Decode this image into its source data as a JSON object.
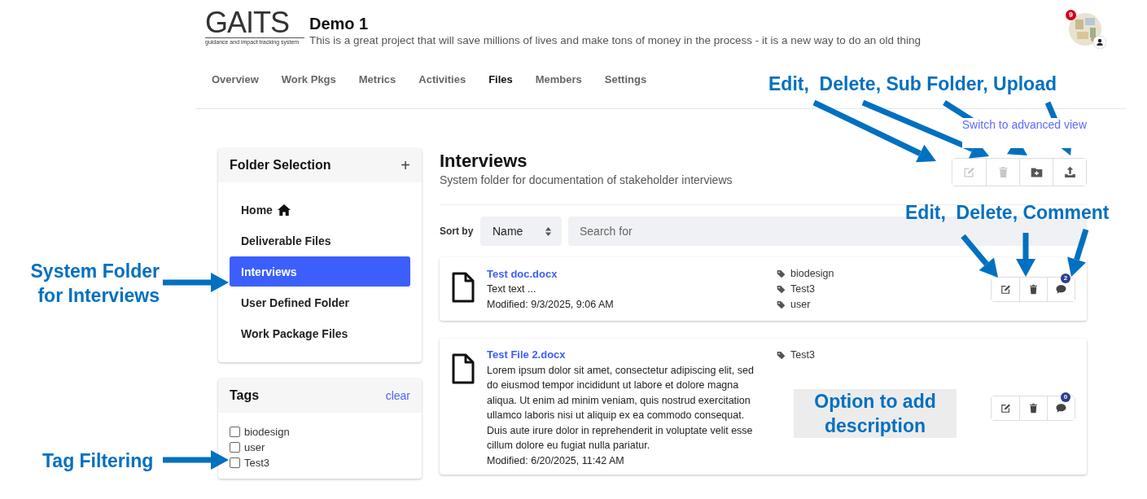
{
  "project": {
    "logo": "GAITS",
    "tagline": "guidance and impact tracking system",
    "title": "Demo 1",
    "description": "This is a great project that will save millions of lives and make tons of money in the process - it is a new way to do an old thing",
    "notifications": "9"
  },
  "tabs": [
    {
      "label": "Overview",
      "selected": false
    },
    {
      "label": "Work Pkgs",
      "selected": false
    },
    {
      "label": "Metrics",
      "selected": false
    },
    {
      "label": "Activities",
      "selected": false
    },
    {
      "label": "Files",
      "selected": true
    },
    {
      "label": "Members",
      "selected": false
    },
    {
      "label": "Settings",
      "selected": false
    }
  ],
  "view_link": "Switch to advanced view",
  "folder_panel": {
    "title": "Folder Selection",
    "add": "+",
    "folders": [
      {
        "label": "Home",
        "kind": "home",
        "selected": false
      },
      {
        "label": "Deliverable Files",
        "kind": "folder",
        "selected": false
      },
      {
        "label": "Interviews",
        "kind": "folder",
        "selected": true
      },
      {
        "label": "User Defined Folder",
        "kind": "folder",
        "selected": false
      },
      {
        "label": "Work Package Files",
        "kind": "folder",
        "selected": false
      }
    ]
  },
  "tags_panel": {
    "title": "Tags",
    "clear": "clear",
    "tags": [
      {
        "label": "biodesign",
        "checked": false
      },
      {
        "label": "user",
        "checked": false
      },
      {
        "label": "Test3",
        "checked": false
      }
    ]
  },
  "folder": {
    "title": "Interviews",
    "description": "System folder for documentation of stakeholder interviews",
    "actions": [
      {
        "kind": "edit",
        "disabled": true
      },
      {
        "kind": "delete",
        "disabled": true
      },
      {
        "kind": "subfolder",
        "disabled": false
      },
      {
        "kind": "upload",
        "disabled": false
      }
    ]
  },
  "sort": {
    "label": "Sort by",
    "value": "Name"
  },
  "search": {
    "placeholder": "Search for"
  },
  "files": [
    {
      "name": "Test doc.docx",
      "description": "Text text ...",
      "modified": "Modified: 9/3/2025, 9:06 AM",
      "tags": [
        "biodesign",
        "Test3",
        "user"
      ],
      "comments": "2"
    },
    {
      "name": "Test File 2.docx",
      "description": "Lorem ipsum dolor sit amet, consectetur adipiscing elit, sed do eiusmod tempor incididunt ut labore et dolore magna aliqua. Ut enim ad minim veniam, quis nostrud exercitation ullamco laboris nisi ut aliquip ex ea commodo consequat. Duis aute irure dolor in reprehenderit in voluptate velit esse cillum dolore eu fugiat nulla pariatur.",
      "modified": "Modified: 6/20/2025, 11:42 AM",
      "tags": [
        "Test3"
      ],
      "comments": "0"
    }
  ],
  "annotations": [
    {
      "text": "Edit,  Delete, Sub Folder, Upload"
    },
    {
      "text": "Edit,  Delete, Comment"
    },
    {
      "text": "System Folder for Interviews"
    },
    {
      "text": "Tag Filtering"
    },
    {
      "text": "Option to add description"
    }
  ]
}
